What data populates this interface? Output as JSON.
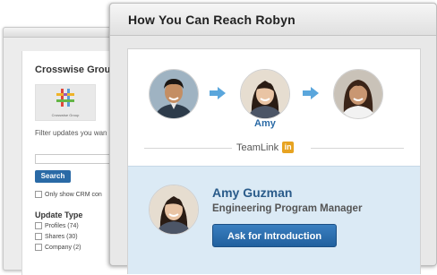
{
  "crm_panel": {
    "title": "Crosswise Group",
    "logo_text": "Crosswise Group",
    "filter_text": "Filter updates you wan",
    "search_button": "Search",
    "crm_checkbox_label": "Only show CRM con",
    "update_type_heading": "Update Type",
    "update_types": [
      {
        "label": "Profiles (74)"
      },
      {
        "label": "Shares (30)"
      },
      {
        "label": "Company (2)"
      }
    ]
  },
  "modal": {
    "title": "How You Can Reach Robyn",
    "path": {
      "middle_name": "Amy",
      "teamlink_label": "TeamLink",
      "teamlink_badge": "in"
    },
    "introducer": {
      "name": "Amy Guzman",
      "role": "Engineering Program Manager",
      "button_label": "Ask for Introduction"
    }
  },
  "colors": {
    "accent_blue": "#2a6aa6",
    "intro_background": "#dbeaf5",
    "arrow_blue": "#5aa6dc",
    "teamlink_badge": "#e7a321"
  }
}
